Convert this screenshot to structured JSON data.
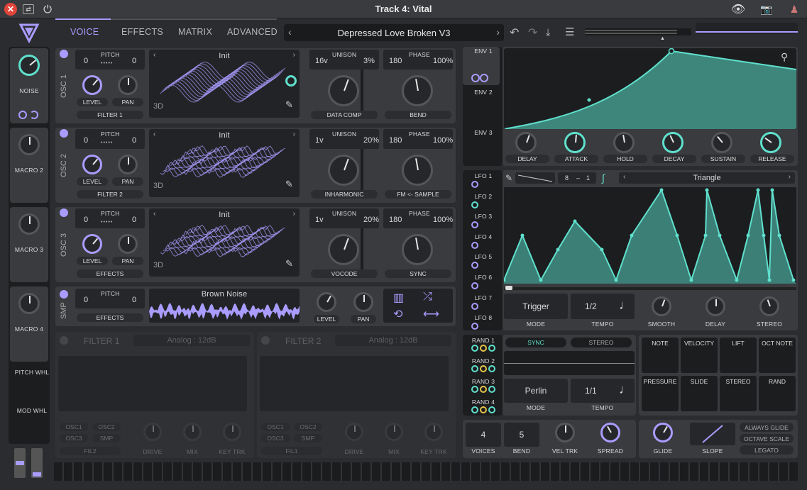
{
  "window": {
    "title": "Track 4: Vital"
  },
  "tabs": [
    {
      "label": "VOICE"
    },
    {
      "label": "EFFECTS"
    },
    {
      "label": "MATRIX"
    },
    {
      "label": "ADVANCED"
    }
  ],
  "preset": {
    "name": "Depressed Love Broken V3"
  },
  "macros": [
    {
      "label": "NOISE"
    },
    {
      "label": "MACRO 2"
    },
    {
      "label": "MACRO 3"
    },
    {
      "label": "MACRO 4"
    }
  ],
  "wheels": {
    "pitch": "PITCH WHL",
    "mod": "MOD WHL"
  },
  "osc": [
    {
      "label": "OSC 1",
      "pitch_left": "0",
      "pitch_right": "0",
      "pitch": "PITCH",
      "level": "LEVEL",
      "pan": "PAN",
      "dest": "FILTER 1",
      "wavetable": "Init",
      "mode3d": "3D",
      "unison": "UNISON",
      "voices": "16v",
      "detune": "3%",
      "phase": "PHASE",
      "phase_val": "180",
      "phase_pct": "100%",
      "warp1": "DATA COMP",
      "warp2": "BEND"
    },
    {
      "label": "OSC 2",
      "pitch_left": "0",
      "pitch_right": "0",
      "pitch": "PITCH",
      "level": "LEVEL",
      "pan": "PAN",
      "dest": "FILTER 2",
      "wavetable": "Init",
      "mode3d": "3D",
      "unison": "UNISON",
      "voices": "1v",
      "detune": "20%",
      "phase": "PHASE",
      "phase_val": "180",
      "phase_pct": "100%",
      "warp1": "INHARMONIC",
      "warp2": "FM <- SAMPLE"
    },
    {
      "label": "OSC 3",
      "pitch_left": "0",
      "pitch_right": "0",
      "pitch": "PITCH",
      "level": "LEVEL",
      "pan": "PAN",
      "dest": "EFFECTS",
      "wavetable": "Init",
      "mode3d": "3D",
      "unison": "UNISON",
      "voices": "1v",
      "detune": "20%",
      "phase": "PHASE",
      "phase_val": "180",
      "phase_pct": "100%",
      "warp1": "VOCODE",
      "warp2": "SYNC"
    }
  ],
  "smp": {
    "label": "SMP",
    "pitch": "PITCH",
    "pitch_left": "0",
    "pitch_right": "0",
    "dest": "EFFECTS",
    "sample": "Brown Noise",
    "level": "LEVEL",
    "pan": "PAN"
  },
  "filters": [
    {
      "title": "FILTER 1",
      "type": "Analog : 12dB",
      "src": [
        "OSC1",
        "OSC2",
        "OSC3",
        "SMP"
      ],
      "dest": "FIL2",
      "drive": "DRIVE",
      "mix": "MIX",
      "keytrk": "KEY TRK"
    },
    {
      "title": "FILTER 2",
      "type": "Analog : 12dB",
      "src": [
        "OSC1",
        "OSC2",
        "OSC3",
        "SMP"
      ],
      "dest": "FIL1",
      "drive": "DRIVE",
      "mix": "MIX",
      "keytrk": "KEY TRK"
    }
  ],
  "env": {
    "tabs": [
      "ENV 1",
      "ENV 2",
      "ENV 3"
    ],
    "knobs": [
      "DELAY",
      "ATTACK",
      "HOLD",
      "DECAY",
      "SUSTAIN",
      "RELEASE"
    ]
  },
  "lfo": {
    "tabs": [
      "LFO 1",
      "LFO 2",
      "LFO 3",
      "LFO 4",
      "LFO 5",
      "LFO 6",
      "LFO 7",
      "LFO 8"
    ],
    "grid_x": "8",
    "grid_y": "1",
    "shape": "Triangle",
    "mode": "Trigger",
    "mode_lbl": "MODE",
    "tempo": "1/2",
    "tempo_lbl": "TEMPO",
    "knobs": [
      "SMOOTH",
      "DELAY",
      "STEREO"
    ]
  },
  "random": {
    "tabs": [
      "RAND 1",
      "RAND 2",
      "RAND 3",
      "RAND 4"
    ],
    "sync": "SYNC",
    "stereo": "STEREO",
    "style": "Perlin",
    "mode_lbl": "MODE",
    "tempo": "1/1",
    "tempo_lbl": "TEMPO"
  },
  "modsrc": [
    "NOTE",
    "VELOCITY",
    "LIFT",
    "OCT NOTE",
    "PRESSURE",
    "SLIDE",
    "STEREO",
    "RAND"
  ],
  "voice": {
    "voices": "4",
    "voices_lbl": "VOICES",
    "bend": "5",
    "bend_lbl": "BEND",
    "veltrk": "VEL TRK",
    "spread": "SPREAD"
  },
  "glide": {
    "glide": "GLIDE",
    "slope": "SLOPE",
    "always": "ALWAYS GLIDE",
    "octave": "OCTAVE SCALE",
    "legato": "LEGATO"
  },
  "colors": {
    "accent": "#a99cff",
    "teal": "#5fe0cd",
    "bg": "#2b2c2f"
  }
}
